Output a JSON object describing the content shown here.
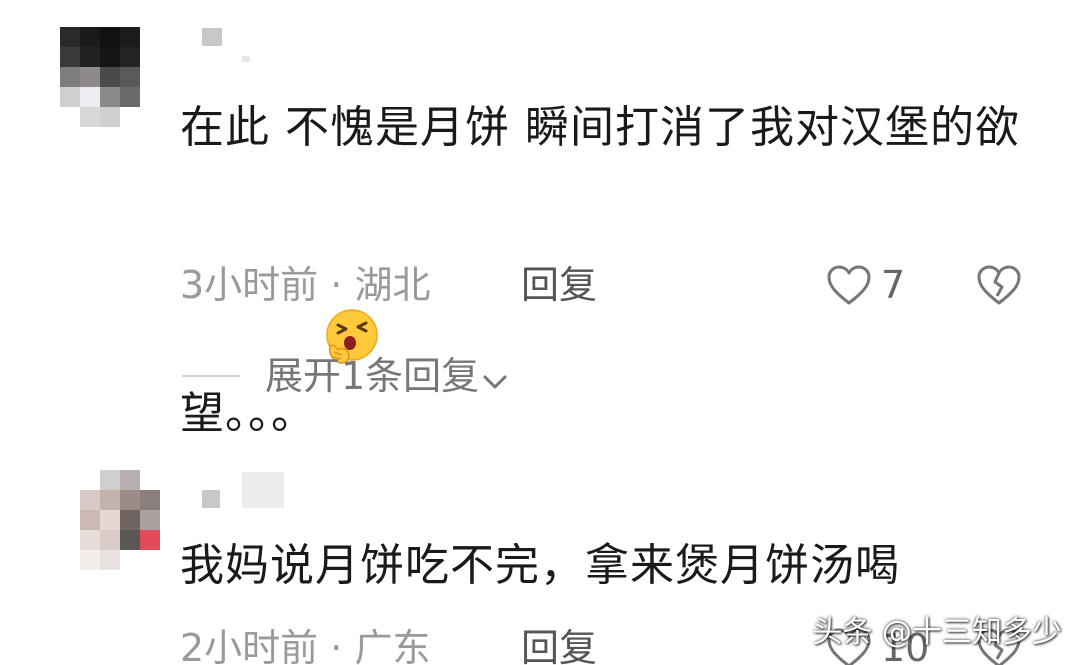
{
  "comments": [
    {
      "text": "在此 不愧是月饼 瞬间打消了我对汉堡的欲望。。。",
      "emoji": "face-with-hand-over-mouth-emoji",
      "time": "3小时前",
      "separator": " · ",
      "location": "湖北",
      "reply_label": "回复",
      "like_count": "7",
      "expand_label": "展开1条回复"
    },
    {
      "text": "我妈说月饼吃不完，拿来煲月饼汤喝",
      "time": "2小时前",
      "separator": " · ",
      "location": "广东",
      "reply_label": "回复",
      "like_count": "10"
    }
  ],
  "watermark": "头条 @十三知多少",
  "colors": {
    "text": "#1a1a1a",
    "meta": "#9a9a9a",
    "reply": "#555555",
    "icon_stroke": "#777777"
  }
}
